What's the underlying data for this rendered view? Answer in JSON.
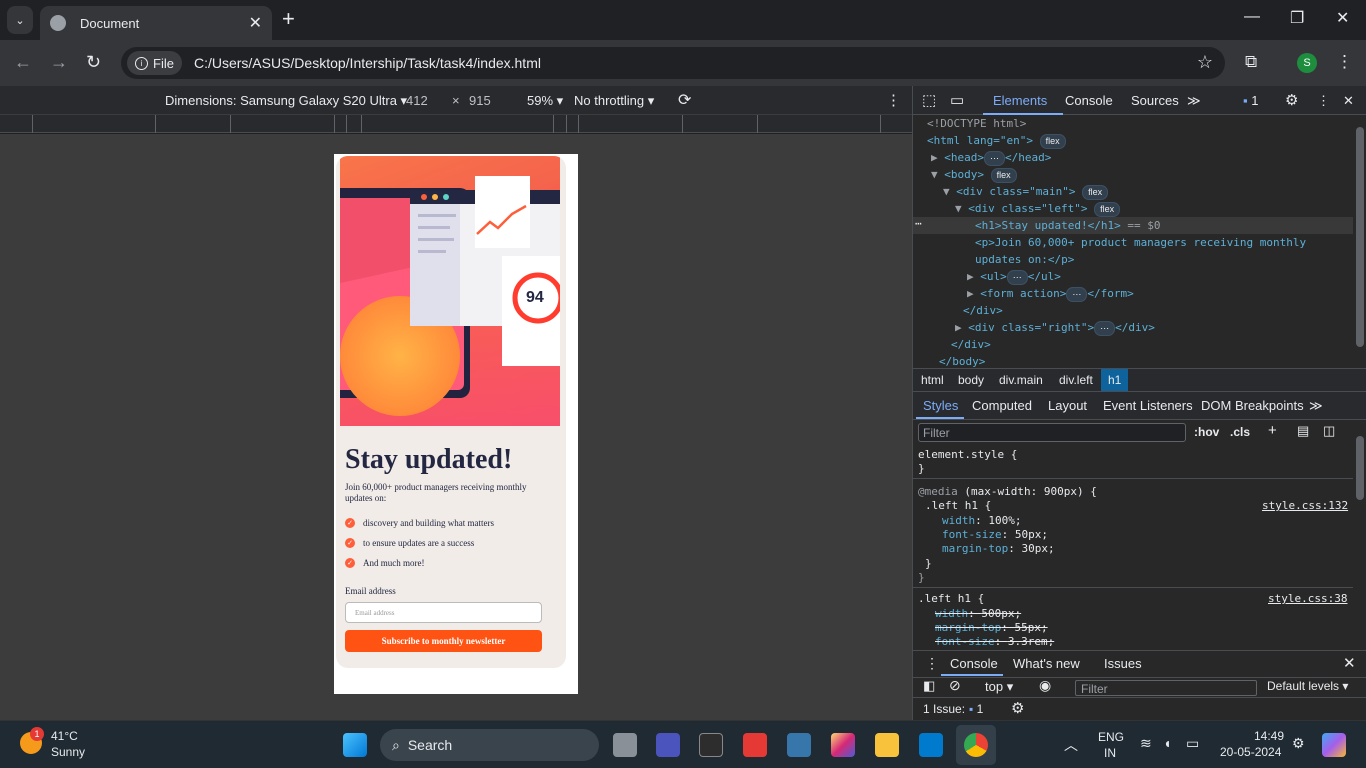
{
  "browser": {
    "tab_title": "Document",
    "url_chip": "File",
    "url": "C:/Users/ASUS/Desktop/Intership/Task/task4/index.html",
    "profile_initial": "S"
  },
  "device_toolbar": {
    "device": "Dimensions: Samsung Galaxy S20 Ultra",
    "width": "412",
    "times": "×",
    "height": "915",
    "zoom": "59%",
    "throttling": "No throttling"
  },
  "page": {
    "heading": "Stay updated!",
    "intro": "Join 60,000+ product managers receiving monthly updates on:",
    "list": [
      "discovery and building what matters",
      "to ensure updates are a success",
      "And much more!"
    ],
    "email_label": "Email address",
    "email_placeholder": "Email address",
    "submit": "Subscribe to monthly newsletter",
    "score": "94"
  },
  "devtools": {
    "tabs": [
      "Elements",
      "Console",
      "Sources"
    ],
    "issues_count": "1",
    "dom": {
      "doctype": "<!DOCTYPE html>",
      "html_open": "<html lang=\"en\">",
      "head": "<head>",
      "head_close": "</head>",
      "body": "<body>",
      "main": "<div class=\"main\">",
      "left": "<div class=\"left\">",
      "h1": "<h1>Stay updated!</h1>",
      "h1_marker": "== $0",
      "p1": "<p>Join 60,000+ product managers receiving monthly",
      "p2": "updates on:</p>",
      "ul": "<ul>",
      "ul_close": "</ul>",
      "form": "<form action>",
      "form_close": "</form>",
      "div_close": "</div>",
      "right": "<div class=\"right\">",
      "right_close": "</div>",
      "main_close": "</div>",
      "body_close": "</body>",
      "flex": "flex",
      "ellipsis": "⋯"
    },
    "breadcrumbs": [
      "html",
      "body",
      "div.main",
      "div.left",
      "h1"
    ],
    "subtabs": [
      "Styles",
      "Computed",
      "Layout",
      "Event Listeners",
      "DOM Breakpoints"
    ],
    "filter_placeholder": "Filter",
    "hov": ":hov",
    "cls": ".cls",
    "styles": {
      "element_style": "element.style {",
      "close": "}",
      "media": "@media",
      "media_query": "(max-width: 900px) {",
      "rule1_selector": ".left h1 {",
      "rule1_source": "style.css:132",
      "rule1_props": [
        {
          "name": "width",
          "value": "100%;"
        },
        {
          "name": "font-size",
          "value": "50px;"
        },
        {
          "name": "margin-top",
          "value": "30px;"
        }
      ],
      "rule2_selector": ".left h1 {",
      "rule2_source": "style.css:38",
      "rule2_props": [
        {
          "name": "width",
          "value": "500px;"
        },
        {
          "name": "margin-top",
          "value": "55px;"
        },
        {
          "name": "font-size",
          "value": "3.3rem;"
        }
      ]
    },
    "drawer": {
      "tabs": [
        "Console",
        "What's new",
        "Issues"
      ],
      "context": "top",
      "filter": "Filter",
      "levels": "Default levels",
      "issues": "1 Issue:",
      "issues_count": "1"
    }
  },
  "taskbar": {
    "weather_temp": "41°C",
    "weather_desc": "Sunny",
    "weather_badge": "1",
    "search": "Search",
    "lang1": "ENG",
    "lang2": "IN",
    "time": "14:49",
    "date": "20-05-2024"
  }
}
